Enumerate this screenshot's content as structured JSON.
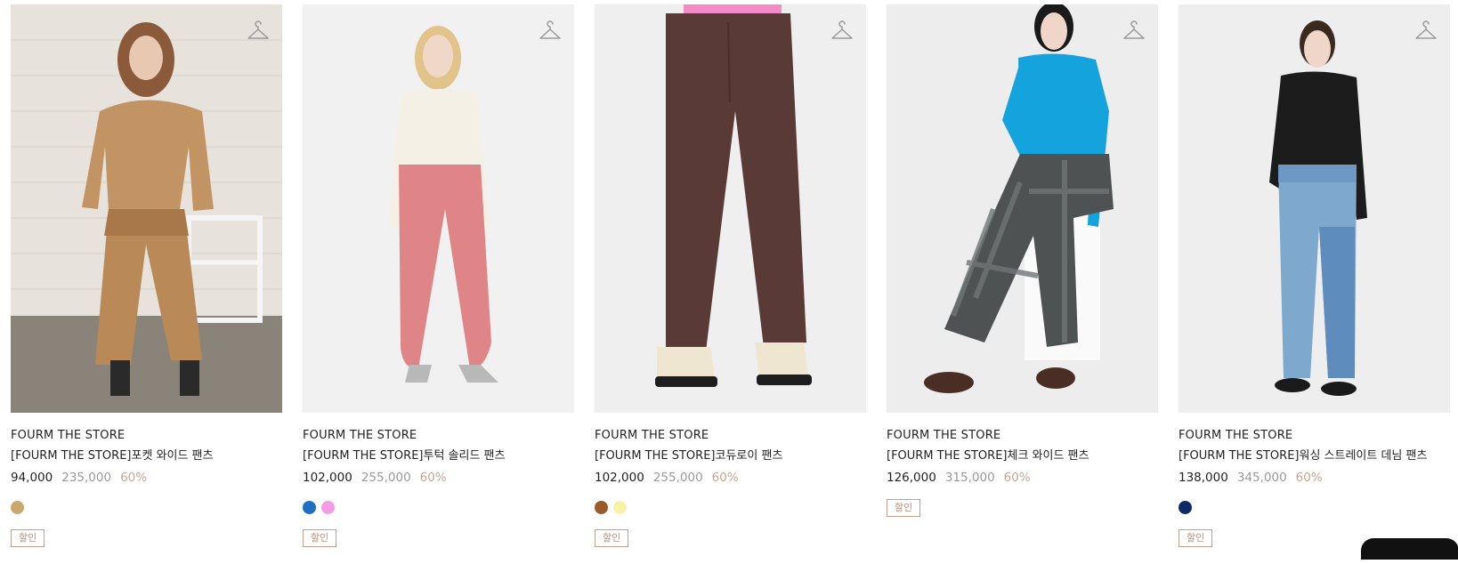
{
  "products": [
    {
      "brand": "FOURM THE STORE",
      "name": "[FOURM THE STORE]포켓 와이드 팬츠",
      "price": "94,000",
      "original_price": "235,000",
      "discount": "60%",
      "swatches": [
        "#c8a96b"
      ],
      "badge": "할인",
      "hanger_icon": "hanger-icon",
      "image_colors": {
        "bg": "#d8d4cc",
        "wall": "#e9e6e0",
        "floor": "#8a8379",
        "outfit": "#c39463",
        "outfit_dark": "#a87848",
        "hair": "#8a5a3a",
        "skin": "#e8c8b0",
        "shoes": "#2a2a2a"
      }
    },
    {
      "brand": "FOURM THE STORE",
      "name": "[FOURM THE STORE]투턱 솔리드 팬츠",
      "price": "102,000",
      "original_price": "255,000",
      "discount": "60%",
      "swatches": [
        "#1c6fc4",
        "#f49be6"
      ],
      "badge": "할인",
      "hanger_icon": "hanger-icon",
      "image_colors": {
        "bg": "#f1f1f1",
        "top": "#f5f0e6",
        "pants": "#e08587",
        "hair": "#e2c48a",
        "skin": "#f0d8c8",
        "shoes": "#b8b8b8"
      }
    },
    {
      "brand": "FOURM THE STORE",
      "name": "[FOURM THE STORE]코듀로이 팬츠",
      "price": "102,000",
      "original_price": "255,000",
      "discount": "60%",
      "swatches": [
        "#9a5a2a",
        "#fbf0a8"
      ],
      "badge": "할인",
      "hanger_icon": "hanger-icon",
      "image_colors": {
        "bg": "#efefef",
        "pants": "#5a3a36",
        "top": "#f58ac8",
        "boots": "#efe6d2",
        "sole": "#1e1e1e"
      }
    },
    {
      "brand": "FOURM THE STORE",
      "name": "[FOURM THE STORE]체크 와이드 팬츠",
      "price": "126,000",
      "original_price": "315,000",
      "discount": "60%",
      "swatches": [],
      "badge": "할인",
      "hanger_icon": "hanger-icon",
      "image_colors": {
        "bg": "#ededed",
        "top": "#14a3dc",
        "pants": "#4e5252",
        "plaid": "#6f7676",
        "cube": "#fafafa",
        "hair": "#1a1a1a",
        "skin": "#f0d6c8",
        "shoes": "#4a2e26"
      }
    },
    {
      "brand": "FOURM THE STORE",
      "name": "[FOURM THE STORE]워싱 스트레이트 데님 팬츠",
      "price": "138,000",
      "original_price": "345,000",
      "discount": "60%",
      "swatches": [
        "#0e2a6a"
      ],
      "badge": "할인",
      "hanger_icon": "hanger-icon",
      "image_colors": {
        "bg": "#eeeeee",
        "top": "#1c1c1c",
        "jeans": "#7fa8cf",
        "jeans_dark": "#5e8cbc",
        "hair": "#3a2a20",
        "skin": "#f0d6c8",
        "shoes": "#1a1a1a"
      }
    }
  ]
}
